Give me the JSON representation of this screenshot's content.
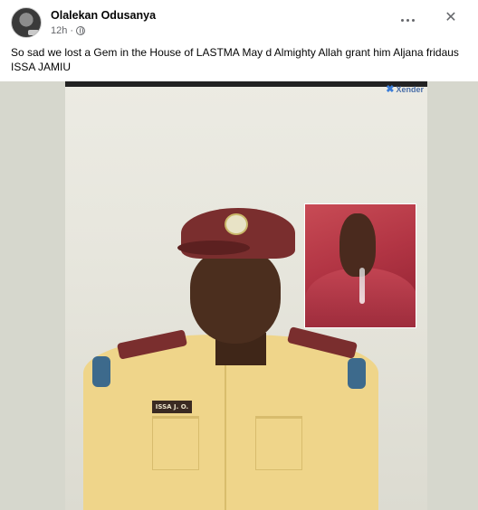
{
  "post": {
    "author": "Olalekan Odusanya",
    "time": "12h",
    "separator": "·",
    "caption_line1": "So sad we lost a Gem in the House of LASTMA May d Almighty Allah grant him Aljana fridaus",
    "caption_line2": "ISSA JAMIU",
    "privacy_icon": "globe-icon"
  },
  "actions": {
    "more_icon": "more-options-icon",
    "close_symbol": "✕"
  },
  "photo": {
    "watermark": "Xender",
    "name_tag": "ISSA J. O."
  },
  "colors": {
    "uniform": "#efd58a",
    "beret": "#7a2e2e",
    "inset_background": "#b23544"
  }
}
